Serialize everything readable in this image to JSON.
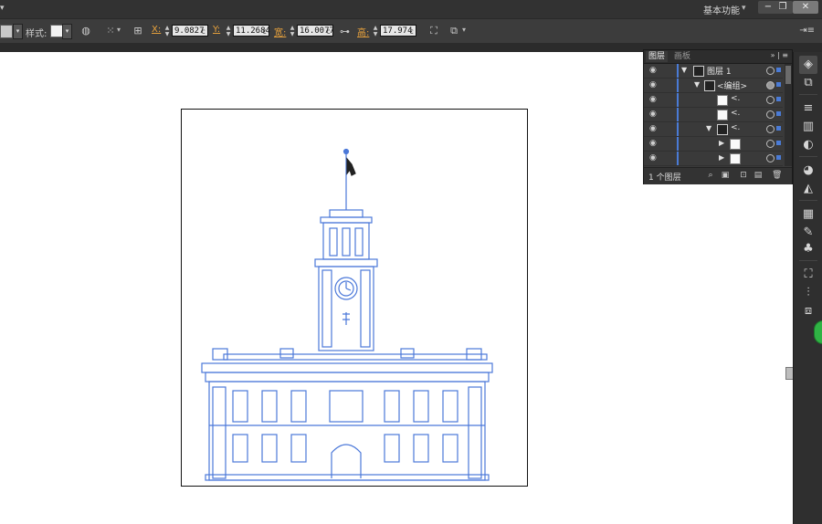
{
  "titlebar": {
    "workspace_label": "基本功能",
    "workspace_caret": "▾",
    "minimize": "−",
    "restore": "❐",
    "close": "✕"
  },
  "control_bar": {
    "style_label": "样式:",
    "x_label": "X:",
    "x_value": "9.0827",
    "y_label": "Y:",
    "y_value": "11.2684",
    "w_label": "宽:",
    "w_value": "16.0077",
    "h_label": "高:",
    "h_value": "17.974",
    "unit": "c",
    "dropdown_caret": "▾"
  },
  "layers_panel": {
    "tabs": [
      "图层",
      "画板"
    ],
    "collapse": "»",
    "menu": "≡",
    "rows": [
      {
        "name": "图层 1",
        "expanded": true
      },
      {
        "name": "<编组>",
        "expanded": true
      },
      {
        "name": "<.",
        "expanded": false
      },
      {
        "name": "<.",
        "expanded": false
      },
      {
        "name": "<.",
        "expanded": true
      },
      {
        "name": "",
        "expanded": false
      },
      {
        "name": "",
        "expanded": false
      },
      {
        "name": "",
        "expanded": false
      }
    ],
    "footer_count": "1 个图层"
  },
  "dock_icons": [
    "layers-icon",
    "artboards-icon",
    "align-icon",
    "gradient-icon",
    "transparency-icon",
    "appearance-icon",
    "graphic-styles-icon",
    "swatches-icon",
    "brushes-icon",
    "symbols-icon",
    "transform-icon",
    "align-panel-icon",
    "pathfinder-icon"
  ],
  "colors": {
    "accent": "#4a7bd6",
    "artwork_stroke": "#4b78d9",
    "label_orange": "#e8a23c",
    "status_green": "#2fb344"
  }
}
